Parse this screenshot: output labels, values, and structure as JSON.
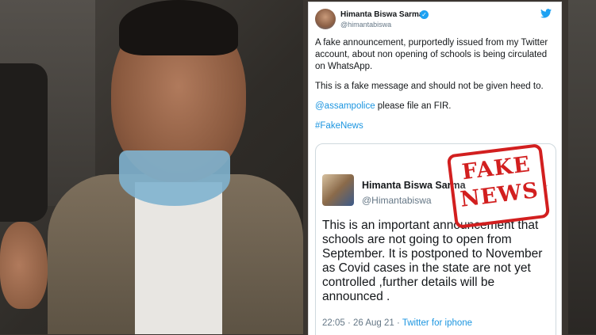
{
  "tweet": {
    "user_name": "Himanta Biswa Sarma",
    "handle": "@himantabiswa",
    "paragraph_1": "A fake announcement, purportedly issued from my Twitter account, about non opening of schools is being circulated on WhatsApp.",
    "paragraph_2": "This is a fake message and should not be given heed to.",
    "mention": "@assampolice",
    "paragraph_3_rest": " please file an FIR.",
    "hashtag": "#FakeNews",
    "icons": [
      "verified-badge",
      "twitter-bird"
    ]
  },
  "embedded_tweet": {
    "user_name": "Himanta Biswa Sarma",
    "handle": "@Himantabiswa",
    "text": "This is an important announcement that schools are not going to open from September. It is postponed to November as Covid cases in the state are not yet controlled ,further details will be announced .",
    "time": "22:05",
    "date": "26 Aug 21",
    "source": "Twitter for iphone"
  },
  "stamp": {
    "line1": "FAKE",
    "line2": "NEWS",
    "color": "#d21f1f"
  },
  "colors": {
    "link": "#1b95e0",
    "verified": "#1da1f2"
  }
}
